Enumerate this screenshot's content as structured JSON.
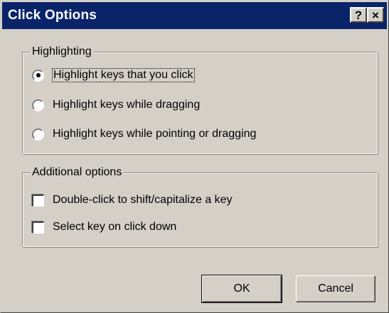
{
  "window": {
    "title": "Click Options"
  },
  "title_buttons": {
    "help": "?",
    "close": "×"
  },
  "highlighting": {
    "label": "Highlighting",
    "options": [
      {
        "label": "Highlight keys that you click",
        "selected": true
      },
      {
        "label": "Highlight keys while dragging",
        "selected": false
      },
      {
        "label": "Highlight keys while pointing or dragging",
        "selected": false
      }
    ]
  },
  "additional": {
    "label": "Additional options",
    "options": [
      {
        "label": "Double-click to shift/capitalize a key",
        "checked": false
      },
      {
        "label": "Select key on click down",
        "checked": false
      }
    ]
  },
  "buttons": {
    "ok": "OK",
    "cancel": "Cancel"
  }
}
